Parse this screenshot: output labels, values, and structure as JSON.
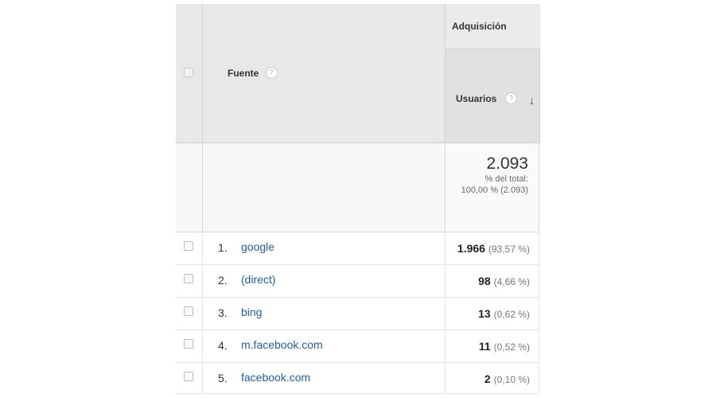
{
  "header": {
    "dimension_label": "Fuente",
    "help_glyph": "?",
    "metric_group_label": "Adquisición",
    "metric_label": "Usuarios",
    "sort_glyph": "↓",
    "sort_icon": "arrow-down-icon",
    "help_icon": "question-circle-icon"
  },
  "totals": {
    "value": "2.093",
    "pct_label": "% del total:",
    "pct_value": "100,00 % (2.093)"
  },
  "rows": [
    {
      "index": "1.",
      "source": "google",
      "value": "1.966",
      "pct": "(93,57 %)"
    },
    {
      "index": "2.",
      "source": "(direct)",
      "value": "98",
      "pct": "(4,66 %)"
    },
    {
      "index": "3.",
      "source": "bing",
      "value": "13",
      "pct": "(0,62 %)"
    },
    {
      "index": "4.",
      "source": "m.facebook.com",
      "value": "11",
      "pct": "(0,52 %)"
    },
    {
      "index": "5.",
      "source": "facebook.com",
      "value": "2",
      "pct": "(0,10 %)"
    }
  ],
  "colors": {
    "link": "#1e5ea8",
    "header_bg": "#e8e8e8",
    "totals_bg": "#f7f7f7"
  }
}
